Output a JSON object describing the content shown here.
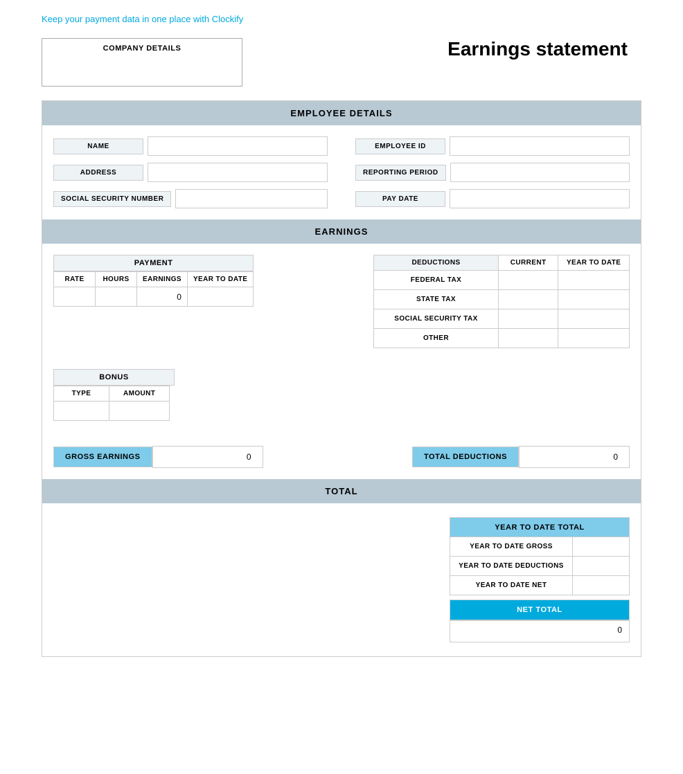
{
  "topLink": {
    "text": "Keep your payment data in one place with Clockify"
  },
  "header": {
    "companyLabel": "COMPANY DETAILS",
    "pageTitle": "Earnings statement"
  },
  "employeeDetails": {
    "sectionLabel": "EMPLOYEE DETAILS",
    "fields": {
      "name": {
        "label": "NAME",
        "value": ""
      },
      "address": {
        "label": "ADDRESS",
        "value": ""
      },
      "ssn": {
        "label": "SOCIAL SECURITY NUMBER",
        "value": ""
      },
      "employeeId": {
        "label": "EMPLOYEE ID",
        "value": ""
      },
      "reportingPeriod": {
        "label": "REPORTING PERIOD",
        "value": ""
      },
      "payDate": {
        "label": "PAY DATE",
        "value": ""
      }
    }
  },
  "earnings": {
    "sectionLabel": "EARNINGS",
    "payment": {
      "headerLabel": "PAYMENT",
      "columns": [
        "RATE",
        "HOURS",
        "EARNINGS",
        "YEAR TO DATE"
      ],
      "rows": [
        {
          "rate": "",
          "hours": "",
          "earnings": "0",
          "yearToDate": ""
        }
      ]
    },
    "deductions": {
      "headerLabel": "DEDUCTIONS",
      "columns": [
        "CURRENT",
        "YEAR TO DATE"
      ],
      "rows": [
        {
          "label": "FEDERAL TAX",
          "current": "",
          "yearToDate": ""
        },
        {
          "label": "STATE TAX",
          "current": "",
          "yearToDate": ""
        },
        {
          "label": "SOCIAL SECURITY TAX",
          "current": "",
          "yearToDate": ""
        },
        {
          "label": "OTHER",
          "current": "",
          "yearToDate": ""
        }
      ]
    },
    "bonus": {
      "headerLabel": "BONUS",
      "columns": [
        "TYPE",
        "AMOUNT"
      ],
      "rows": [
        {
          "type": "",
          "amount": ""
        }
      ]
    },
    "grossEarningsLabel": "GROSS EARNINGS",
    "grossEarningsValue": "0",
    "totalDeductionsLabel": "TOTAL DEDUCTIONS",
    "totalDeductionsValue": "0"
  },
  "total": {
    "sectionLabel": "TOTAL",
    "ytdTotalLabel": "YEAR TO DATE TOTAL",
    "ytdRows": [
      {
        "label": "YEAR TO DATE GROSS",
        "value": ""
      },
      {
        "label": "YEAR TO DATE DEDUCTIONS",
        "value": ""
      },
      {
        "label": "YEAR TO DATE NET",
        "value": ""
      }
    ],
    "netTotalLabel": "NET TOTAL",
    "netTotalValue": "0"
  }
}
